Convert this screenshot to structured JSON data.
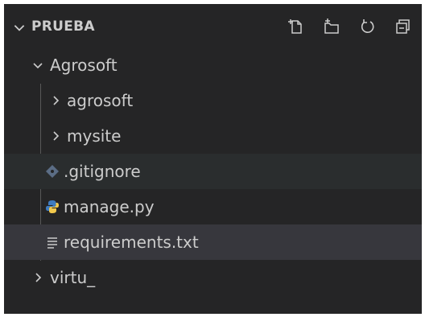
{
  "explorer": {
    "root": "PRUEBA",
    "tools": [
      {
        "icon": "new-file-icon"
      },
      {
        "icon": "new-folder-icon"
      },
      {
        "icon": "refresh-icon"
      },
      {
        "icon": "collapse-all-icon"
      }
    ],
    "tree": [
      {
        "label": "Agrosoft",
        "icon": "chevron-down-icon",
        "type": "folder",
        "expanded": true
      },
      {
        "label": "agrosoft",
        "icon": "chevron-right-icon",
        "type": "folder",
        "expanded": false
      },
      {
        "label": "mysite",
        "icon": "chevron-right-icon",
        "type": "folder",
        "expanded": false
      },
      {
        "label": ".gitignore",
        "icon": "git-icon",
        "type": "file"
      },
      {
        "label": "manage.py",
        "icon": "python-icon",
        "type": "file"
      },
      {
        "label": "requirements.txt",
        "icon": "text-file-icon",
        "type": "file"
      },
      {
        "label": "virtu_",
        "icon": "chevron-right-icon",
        "type": "folder",
        "expanded": false
      }
    ]
  },
  "colors": {
    "background": "#252526",
    "hover_row": "#2a2d2e",
    "selected_row": "#37373d",
    "text": "#cccccc",
    "git_icon": "#5b6d85",
    "python_blue": "#3f7cc0",
    "python_yellow": "#f2c94c"
  }
}
